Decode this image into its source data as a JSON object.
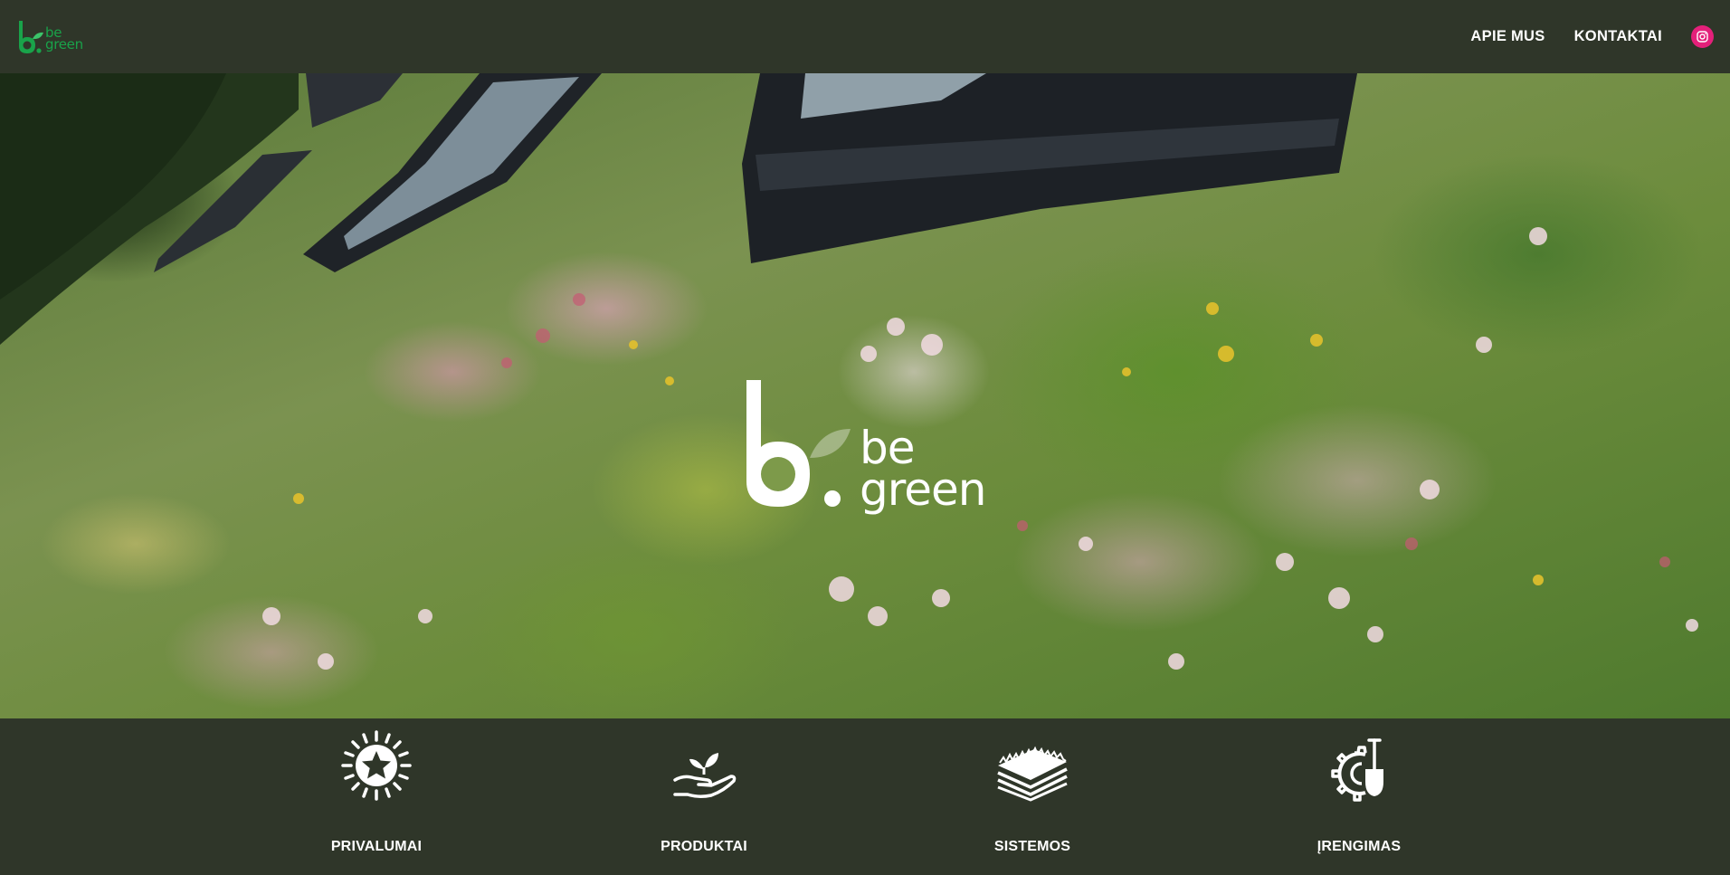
{
  "header": {
    "logo": {
      "mark": "b.",
      "line1": "be",
      "line2": "green"
    },
    "nav": [
      {
        "label": "APIE MUS"
      },
      {
        "label": "KONTAKTAI"
      }
    ],
    "instagram_icon": "instagram-icon",
    "colors": {
      "background": "#2f3629",
      "brand_green": "#19a34a",
      "instagram": "#e4207a"
    }
  },
  "hero": {
    "logo": {
      "mark": "b.",
      "line1": "be",
      "line2": "green"
    },
    "image": "green-roof-flowers"
  },
  "features": [
    {
      "label": "PRIVALUMAI",
      "icon": "sun-star-icon"
    },
    {
      "label": "PRODUKTAI",
      "icon": "hand-sprout-icon"
    },
    {
      "label": "SISTEMOS",
      "icon": "layers-grass-icon"
    },
    {
      "label": "ĮRENGIMAS",
      "icon": "gear-shovel-icon"
    }
  ]
}
